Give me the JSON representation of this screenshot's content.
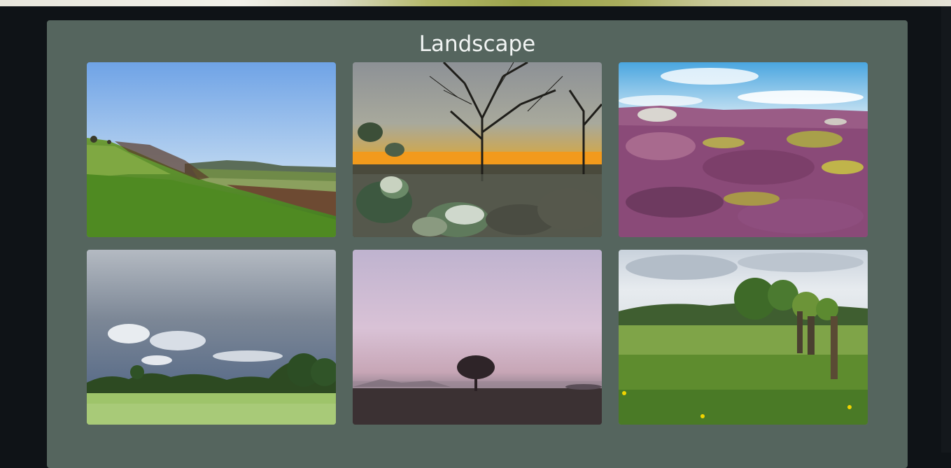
{
  "gallery": {
    "title": "Landscape",
    "photos": [
      {
        "name": "green-hills-valley"
      },
      {
        "name": "frosty-tree-sunset"
      },
      {
        "name": "heather-moorland"
      },
      {
        "name": "wheat-field-cloudy-sky"
      },
      {
        "name": "lone-tree-misty-dawn"
      },
      {
        "name": "meadow-willow-trees"
      }
    ]
  }
}
